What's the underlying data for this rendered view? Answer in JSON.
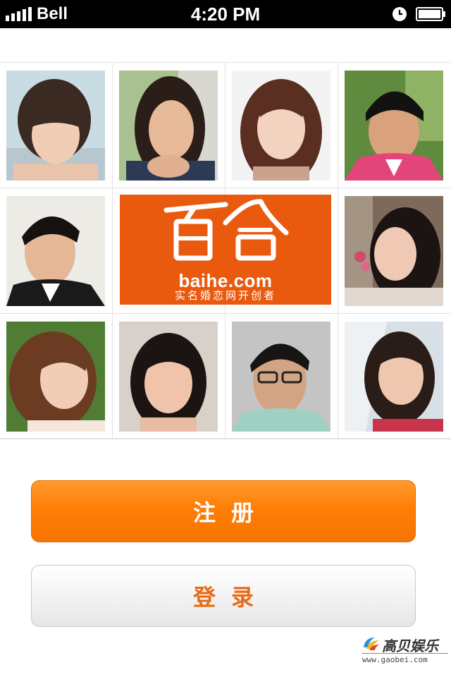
{
  "status_bar": {
    "carrier": "Bell",
    "time": "4:20 PM",
    "signal_icon": "signal-bars-icon",
    "alarm_icon": "alarm-clock-icon",
    "battery_icon": "battery-icon"
  },
  "grid": {
    "logo": {
      "brand_chinese": "百合",
      "domain": "baihe.com",
      "tagline": "实名婚恋网开创者",
      "color": "#ea5a0e"
    }
  },
  "actions": {
    "register_label": "注册",
    "login_label": "登录"
  },
  "watermark": {
    "name": "高贝娱乐",
    "url": "www.gaobei.com"
  }
}
